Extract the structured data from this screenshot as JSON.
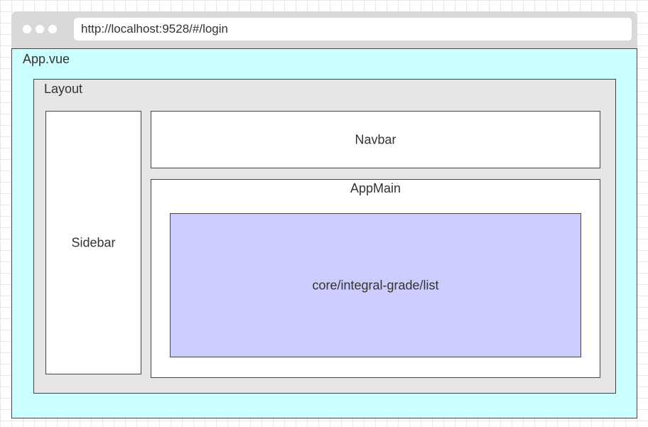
{
  "browser": {
    "url": "http://localhost:9528/#/login"
  },
  "diagram": {
    "app_label": "App.vue",
    "layout_label": "Layout",
    "sidebar_label": "Sidebar",
    "navbar_label": "Navbar",
    "appmain_label": "AppMain",
    "view_label": "core/integral-grade/list"
  },
  "colors": {
    "app_bg": "#ccffff",
    "layout_bg": "#e6e6e6",
    "view_bg": "#ccccff",
    "browser_bar": "#d9d9d9"
  }
}
